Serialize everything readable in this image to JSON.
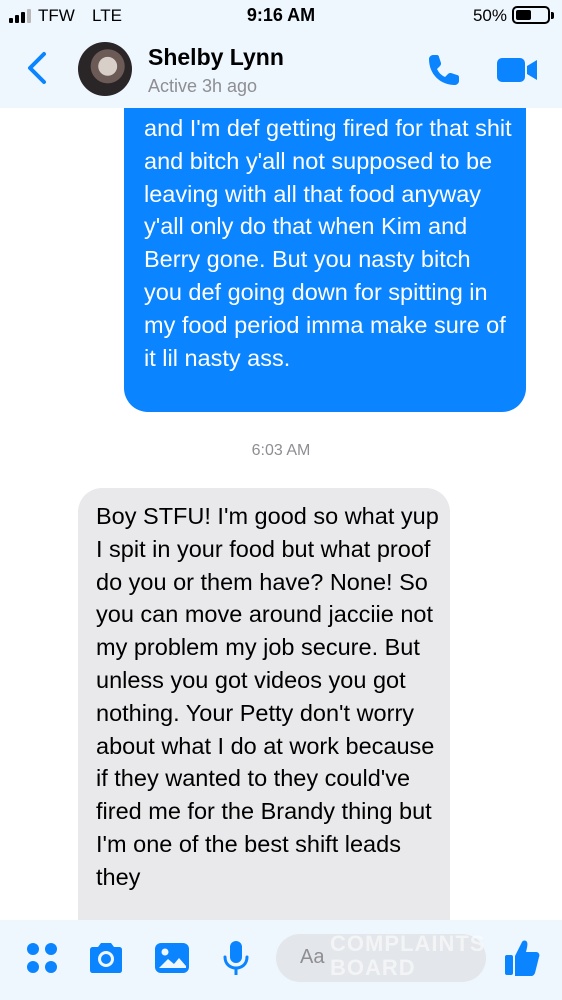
{
  "status_bar": {
    "carrier": "TFW",
    "network": "LTE",
    "time": "9:16 AM",
    "battery": "50%",
    "battery_level": 0.5
  },
  "header": {
    "contact_name": "Shelby Lynn",
    "active_status": "Active 3h ago"
  },
  "messages": {
    "outgoing_text": "and I'm def getting fired for that shit and bitch y'all not supposed to be leaving with all that food anyway y'all only do that when Kim and Berry gone. But you nasty bitch you def going down for spitting in my food period imma make sure of it lil nasty ass.",
    "timestamp": "6:03 AM",
    "incoming_text": "Boy STFU! I'm good so what yup I spit in your food but what proof do you or them have? None! So you can move around jacciie not my problem my job secure. But unless you got videos you got nothing. Your Petty don't worry about what I do at work because if they wanted to they could've fired me for the Brandy thing but I'm one of the best shift leads they"
  },
  "composer": {
    "placeholder": "Aa",
    "watermark_line1": "COMPLAINTS",
    "watermark_line2": "BOARD"
  },
  "icons": [
    "back-chevron-icon",
    "phone-icon",
    "video-camera-icon",
    "apps-grid-icon",
    "camera-icon",
    "image-icon",
    "microphone-icon",
    "thumbs-up-icon"
  ],
  "colors": {
    "accent": "#0a84ff",
    "outgoing_bubble": "#0a84ff",
    "incoming_bubble": "#e9e9eb",
    "bars_bg": "#eef6fe"
  }
}
